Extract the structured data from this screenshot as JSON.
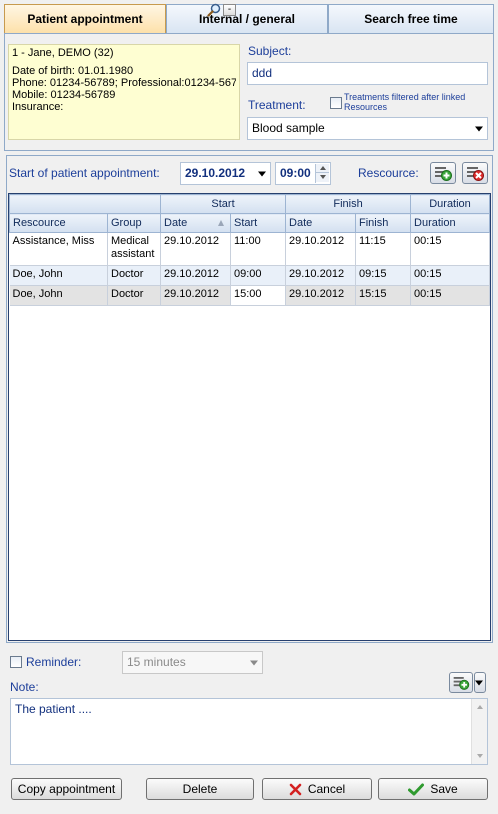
{
  "tabs": [
    {
      "label": "Patient appointment",
      "active": true
    },
    {
      "label": "Internal / general",
      "active": false
    },
    {
      "label": "Search free time",
      "active": false
    }
  ],
  "patient": {
    "name_line": "1 - Jane, DEMO (32)",
    "dob": "Date of birth: 01.01.1980",
    "phone": "Phone: 01234-56789; Professional:01234-56789",
    "mobile": "Mobile: 01234-56789",
    "insurance": "Insurance:",
    "minus_label": "-"
  },
  "subject": {
    "label": "Subject:",
    "value": "ddd"
  },
  "treatment": {
    "label": "Treatment:",
    "filter_label": "Treatments filtered after linked Resources",
    "value": "Blood sample"
  },
  "start": {
    "label": "Start of patient appointment:",
    "date": "29.10.2012",
    "time": "09:00",
    "resource_label": "Rescource:"
  },
  "table": {
    "groups": {
      "start": "Start",
      "finish": "Finish",
      "duration": "Duration"
    },
    "columns": [
      "Rescource",
      "Group",
      "Date",
      "Start",
      "Date",
      "Finish",
      "Duration"
    ],
    "rows": [
      {
        "resource": "Assistance, Miss",
        "group1": "Medical",
        "group2": "assistant",
        "sdate": "29.10.2012",
        "start": "11:00",
        "fdate": "29.10.2012",
        "finish": "11:15",
        "duration": "00:15"
      },
      {
        "resource": "Doe, John",
        "group1": "Doctor",
        "sdate": "29.10.2012",
        "start": "09:00",
        "fdate": "29.10.2012",
        "finish": "09:15",
        "duration": "00:15"
      },
      {
        "resource": "Doe, John",
        "group1": "Doctor",
        "sdate": "29.10.2012",
        "start": "15:00",
        "fdate": "29.10.2012",
        "finish": "15:15",
        "duration": "00:15"
      }
    ]
  },
  "reminder": {
    "label": "Reminder:",
    "value": "15 minutes"
  },
  "note": {
    "label": "Note:",
    "value": "The patient ...."
  },
  "buttons": {
    "copy": "Copy appointment",
    "delete": "Delete",
    "cancel": "Cancel",
    "save": "Save"
  },
  "colors": {
    "accent_tab": "#fde0a8",
    "label_blue": "#1c3e9a",
    "field_text": "#12307e"
  }
}
